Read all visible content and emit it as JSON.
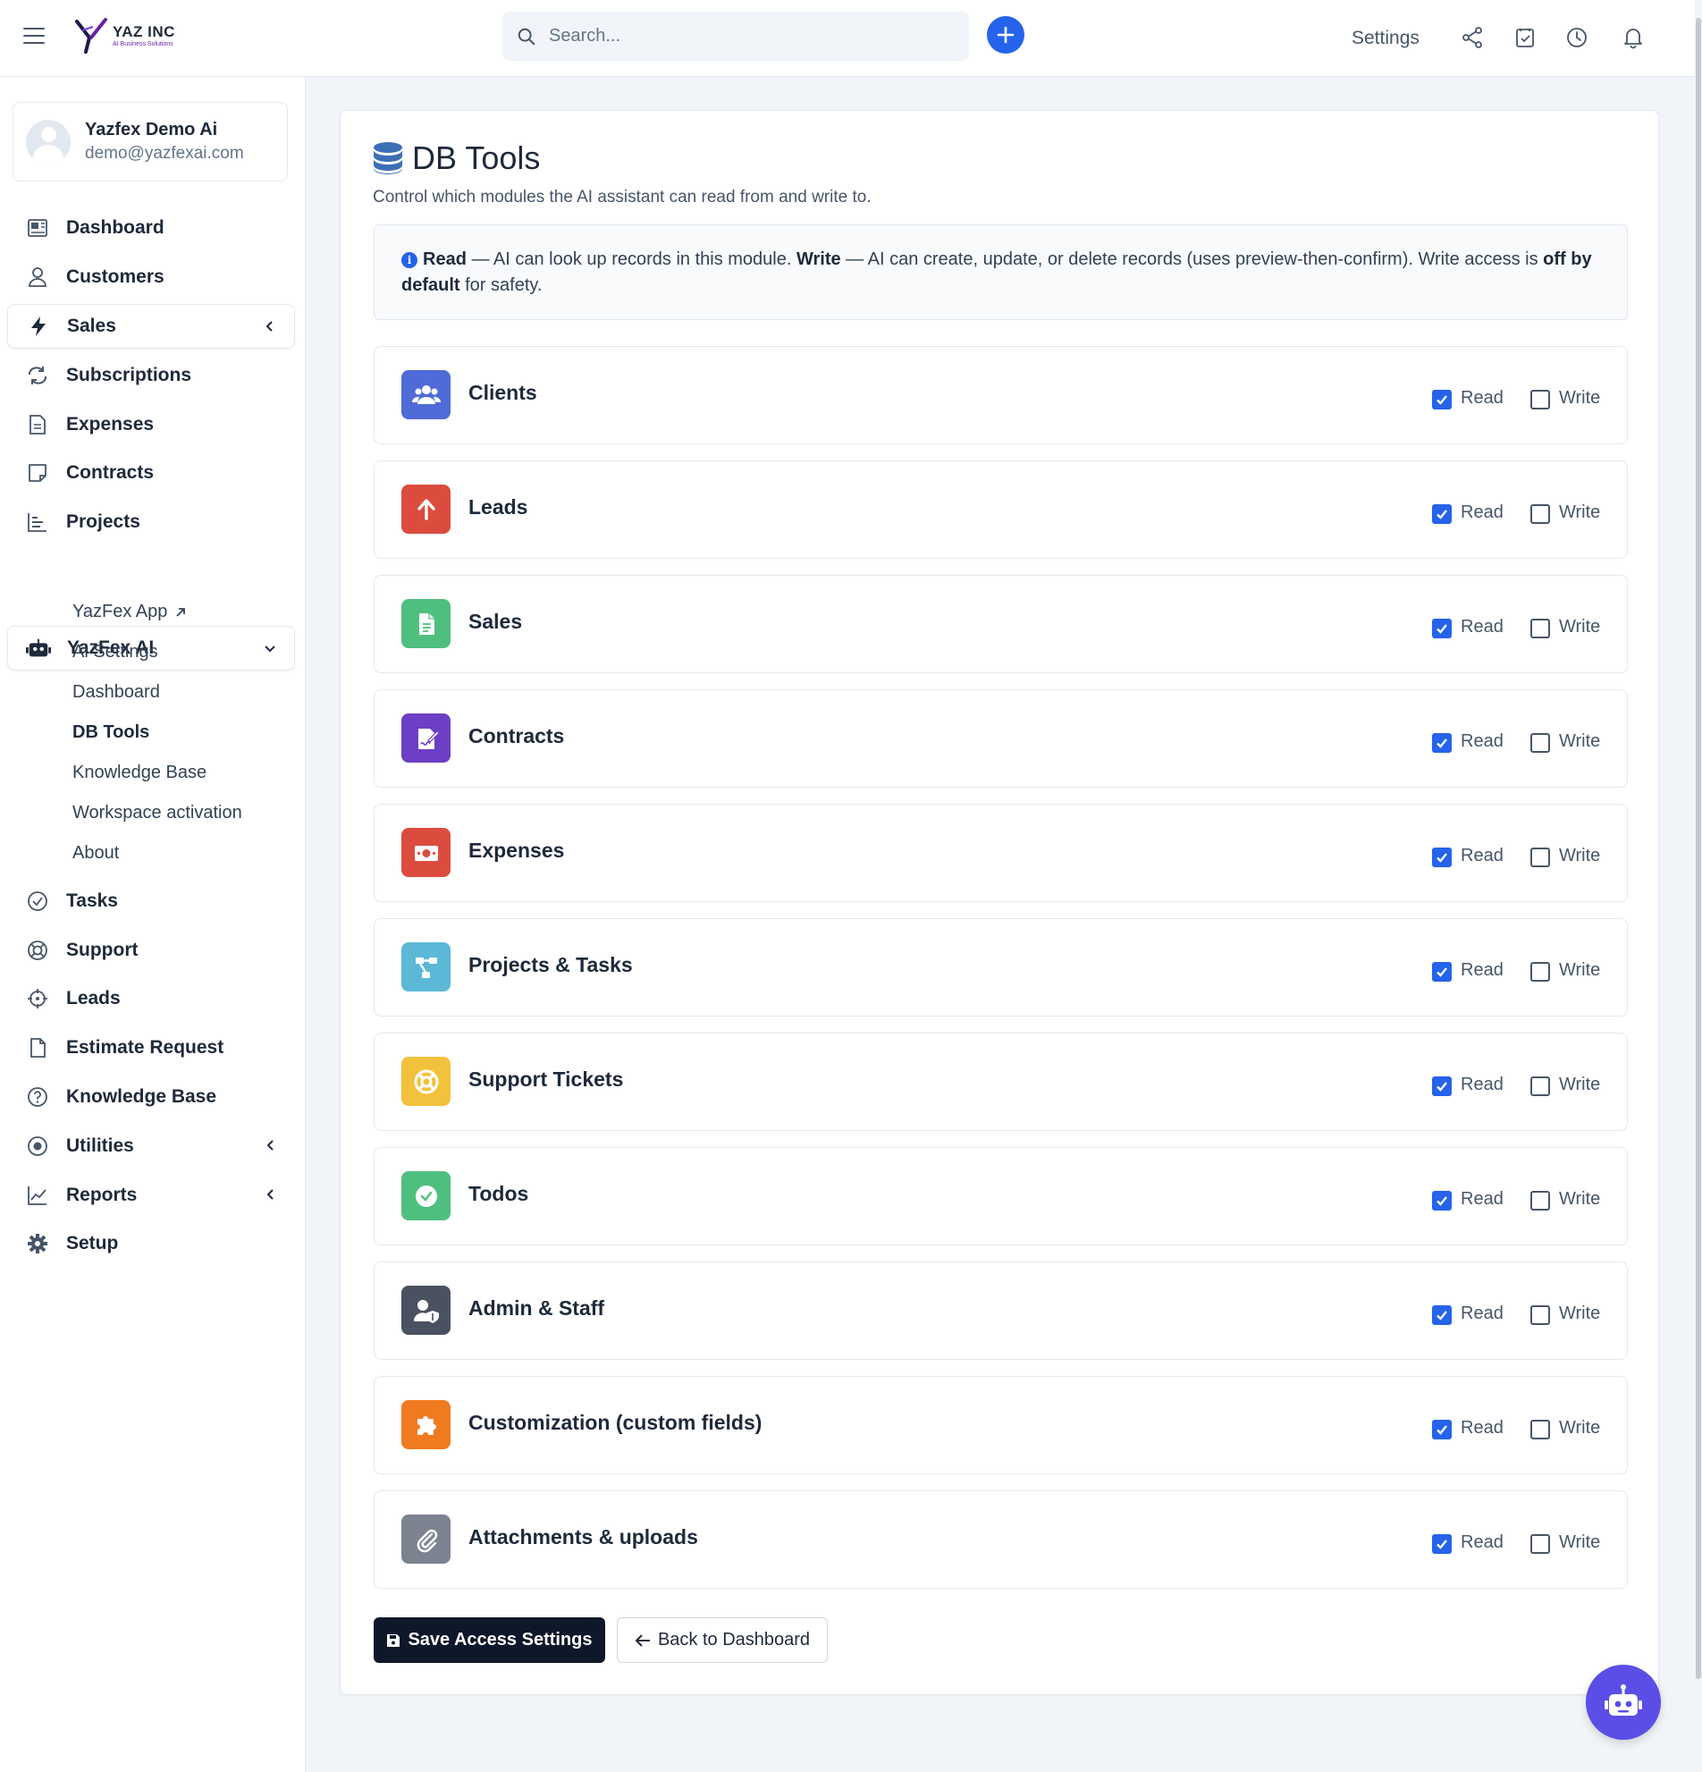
{
  "brand": {
    "name": "YAZ INC",
    "tagline": "AI Business Solutions"
  },
  "search": {
    "placeholder": "Search..."
  },
  "topbar": {
    "settings_label": "Settings"
  },
  "user": {
    "name": "Yazfex Demo Ai",
    "email": "demo@yazfexai.com"
  },
  "sidebar": {
    "items": [
      {
        "label": "Dashboard"
      },
      {
        "label": "Customers"
      },
      {
        "label": "Sales"
      },
      {
        "label": "Subscriptions"
      },
      {
        "label": "Expenses"
      },
      {
        "label": "Contracts"
      },
      {
        "label": "Projects"
      },
      {
        "label": "YazFex AI"
      },
      {
        "label": "Tasks"
      },
      {
        "label": "Support"
      },
      {
        "label": "Leads"
      },
      {
        "label": "Estimate Request"
      },
      {
        "label": "Knowledge Base"
      },
      {
        "label": "Utilities"
      },
      {
        "label": "Reports"
      },
      {
        "label": "Setup"
      }
    ],
    "ai_submenu": [
      {
        "label": "YazFex App"
      },
      {
        "label": "Ai Settings"
      },
      {
        "label": "Dashboard"
      },
      {
        "label": "DB Tools"
      },
      {
        "label": "Knowledge Base"
      },
      {
        "label": "Workspace activation"
      },
      {
        "label": "About"
      }
    ]
  },
  "page": {
    "title": "DB Tools",
    "subtitle": "Control which modules the AI assistant can read from and write to.",
    "info": {
      "read_label": "Read",
      "read_text": " — AI can look up records in this module. ",
      "write_label": "Write",
      "write_text": " — AI can create, update, or delete records (uses preview-then-confirm). Write access is ",
      "default_label": "off by default",
      "end_text": " for safety."
    },
    "read_label": "Read",
    "write_label": "Write",
    "modules": [
      {
        "name": "Clients",
        "read": true,
        "write": false,
        "color": "#4f6bd8",
        "icon": "users-icon"
      },
      {
        "name": "Leads",
        "read": true,
        "write": false,
        "color": "#dc4c3e",
        "icon": "arrow-up-icon"
      },
      {
        "name": "Sales",
        "read": true,
        "write": false,
        "color": "#4fbf7f",
        "icon": "invoice-icon"
      },
      {
        "name": "Contracts",
        "read": true,
        "write": false,
        "color": "#6c3fc4",
        "icon": "signature-icon"
      },
      {
        "name": "Expenses",
        "read": true,
        "write": false,
        "color": "#dc4c3e",
        "icon": "money-bill-icon"
      },
      {
        "name": "Projects & Tasks",
        "read": true,
        "write": false,
        "color": "#5bb8d6",
        "icon": "project-diagram-icon"
      },
      {
        "name": "Support Tickets",
        "read": true,
        "write": false,
        "color": "#f2c23c",
        "icon": "life-ring-icon"
      },
      {
        "name": "Todos",
        "read": true,
        "write": false,
        "color": "#4fbf7f",
        "icon": "check-circle-icon"
      },
      {
        "name": "Admin & Staff",
        "read": true,
        "write": false,
        "color": "#4a5160",
        "icon": "user-shield-icon"
      },
      {
        "name": "Customization (custom fields)",
        "read": true,
        "write": false,
        "color": "#f07a1f",
        "icon": "puzzle-icon"
      },
      {
        "name": "Attachments & uploads",
        "read": true,
        "write": false,
        "color": "#7d8290",
        "icon": "paperclip-icon"
      }
    ],
    "save_label": "Save Access Settings",
    "back_label": "Back to Dashboard"
  }
}
